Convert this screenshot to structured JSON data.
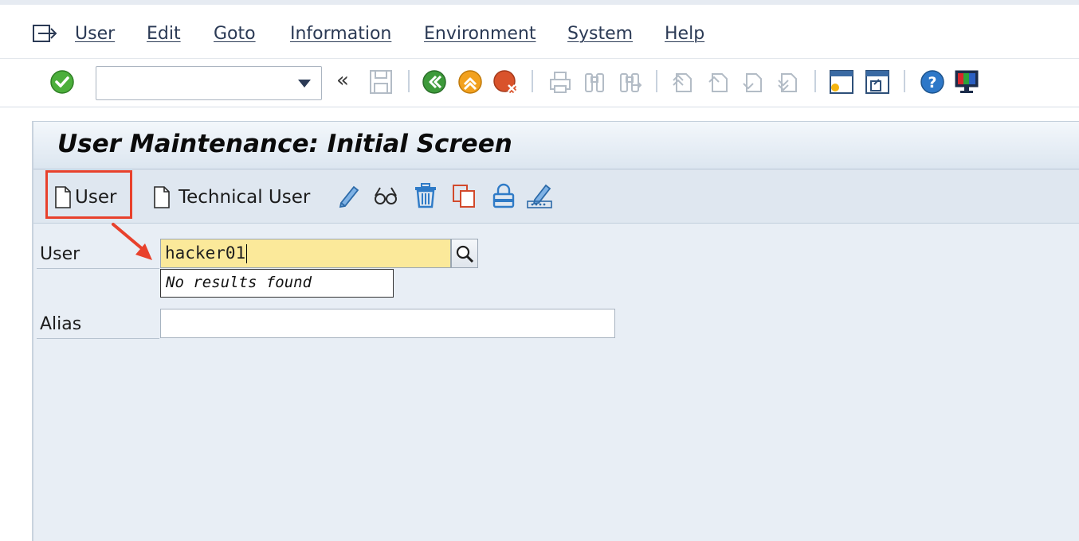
{
  "menu": {
    "items": [
      {
        "label": "User"
      },
      {
        "label": "Edit"
      },
      {
        "label": "Goto"
      },
      {
        "label": "Information"
      },
      {
        "label": "Environment"
      },
      {
        "label": "System"
      },
      {
        "label": "Help"
      }
    ]
  },
  "toolbar": {
    "command_field_value": "",
    "nav_back_glyph": "«"
  },
  "screen": {
    "title": "User Maintenance: Initial Screen"
  },
  "app_toolbar": {
    "create_user_label": "User",
    "technical_user_label": "Technical User"
  },
  "form": {
    "user_label": "User",
    "user_value": "hacker01",
    "search_hint": "No results found",
    "alias_label": "Alias",
    "alias_value": ""
  },
  "colors": {
    "highlight_box": "#e8412c",
    "input_active_bg": "#fbe99a"
  }
}
